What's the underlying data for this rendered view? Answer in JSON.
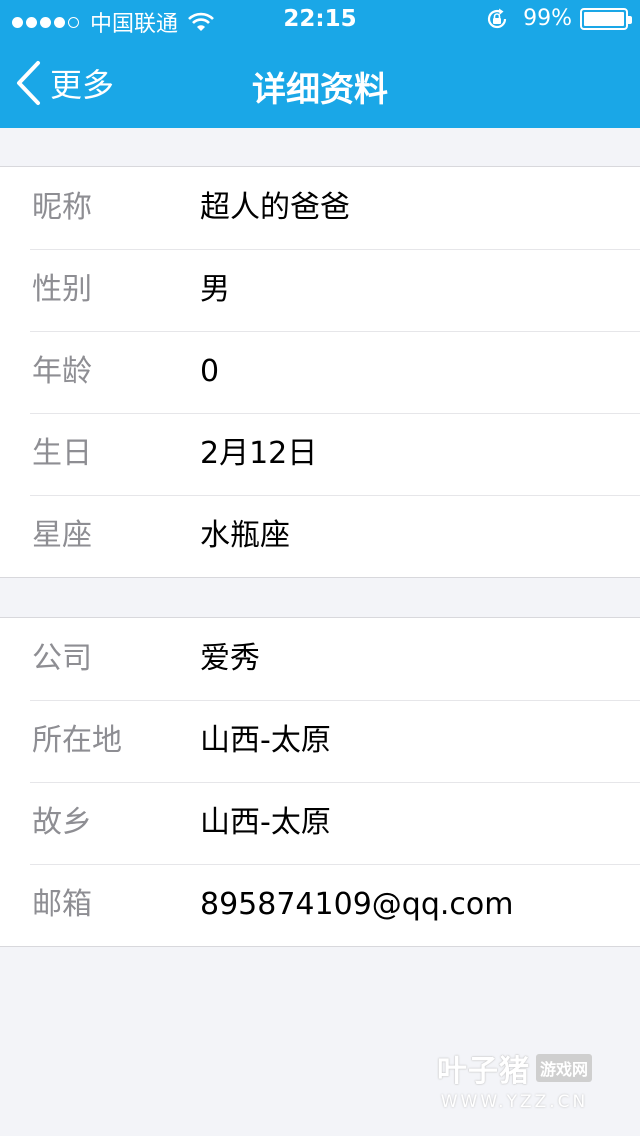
{
  "status_bar": {
    "carrier": "中国联通",
    "time": "22:15",
    "battery": "99%",
    "signal_dots_filled": 4,
    "signal_dots_total": 5
  },
  "nav": {
    "back_label": "更多",
    "title": "详细资料"
  },
  "basic_info": [
    {
      "label": "昵称",
      "value": "超人的爸爸"
    },
    {
      "label": "性别",
      "value": "男"
    },
    {
      "label": "年龄",
      "value": "0"
    },
    {
      "label": "生日",
      "value": "2月12日"
    },
    {
      "label": "星座",
      "value": "水瓶座"
    }
  ],
  "extra_info": [
    {
      "label": "公司",
      "value": "爱秀"
    },
    {
      "label": "所在地",
      "value": "山西-太原"
    },
    {
      "label": "故乡",
      "value": "山西-太原"
    },
    {
      "label": "邮箱",
      "value": "895874109@qq.com"
    }
  ],
  "watermark": {
    "brand": "叶子猪",
    "tag": "游戏网",
    "url": "WWW.YZZ.CN"
  },
  "colors": {
    "header": "#1aa7e7",
    "background": "#f3f4f8",
    "label": "#8e8e93",
    "value": "#000000"
  }
}
